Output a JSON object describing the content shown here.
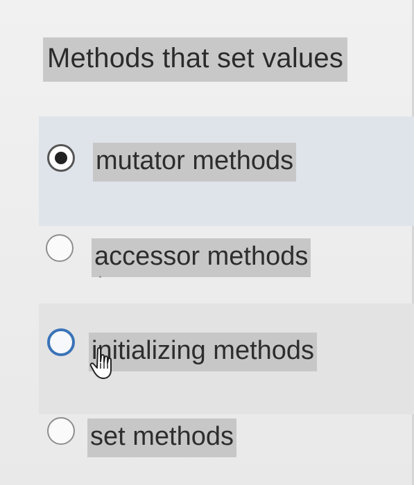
{
  "question": {
    "text": "Methods that set values"
  },
  "options": [
    {
      "label": "mutator methods",
      "selected": true
    },
    {
      "label": "accessor methods",
      "selected": false
    },
    {
      "label": "initializing methods",
      "selected": false
    },
    {
      "label": "set methods",
      "selected": false
    }
  ],
  "colors": {
    "selected_row_bg": "#dfe3ea",
    "hover_row_bg": "#e3e3e3",
    "label_highlight": "#c7c7c7",
    "focus_ring": "#3a73b8"
  },
  "icons": {
    "cursor": "hand-pointer-icon"
  }
}
